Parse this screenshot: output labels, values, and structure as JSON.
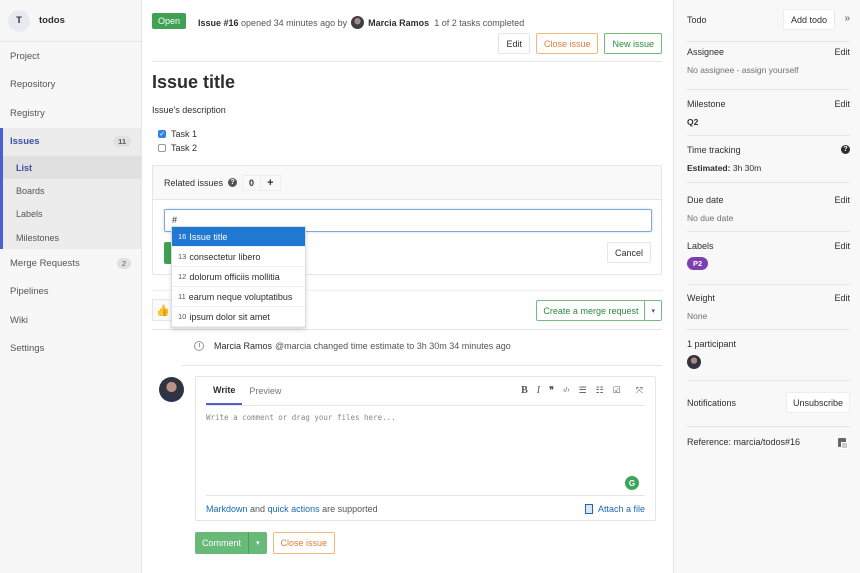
{
  "sidebar": {
    "project_initial": "T",
    "project_name": "todos",
    "items": [
      {
        "label": "Project"
      },
      {
        "label": "Repository"
      },
      {
        "label": "Registry"
      },
      {
        "label": "Issues",
        "badge": "11"
      },
      {
        "label": "Merge Requests",
        "badge": "2"
      },
      {
        "label": "Pipelines"
      },
      {
        "label": "Wiki"
      },
      {
        "label": "Settings"
      }
    ],
    "issues_subitems": [
      {
        "label": "List"
      },
      {
        "label": "Boards"
      },
      {
        "label": "Labels"
      },
      {
        "label": "Milestones"
      }
    ]
  },
  "header": {
    "status": "Open",
    "issue_ref": "Issue #16",
    "opened_text": "opened 34 minutes ago by",
    "author": "Marcia Ramos",
    "tasks_completed": "1 of 2 tasks completed",
    "buttons": {
      "edit": "Edit",
      "close": "Close issue",
      "new": "New issue"
    }
  },
  "issue": {
    "title": "Issue title",
    "description": "Issue's description",
    "tasks": [
      {
        "label": "Task 1",
        "checked": true
      },
      {
        "label": "Task 2",
        "checked": false
      }
    ]
  },
  "related": {
    "title": "Related issues",
    "count": "0",
    "add_icon": "+",
    "input_value": "#",
    "cancel_label": "Cancel",
    "suggestions": [
      {
        "num": "16",
        "title": "Issue title"
      },
      {
        "num": "13",
        "title": "consectetur libero"
      },
      {
        "num": "12",
        "title": "dolorum officiis mollitia"
      },
      {
        "num": "11",
        "title": "earum neque voluptatibus"
      },
      {
        "num": "10",
        "title": "ipsum dolor sit amet"
      }
    ]
  },
  "awards": {
    "thumbs_up_icon": "👍",
    "create_mr_label": "Create a merge request",
    "dropdown_icon": "▾"
  },
  "system_note": {
    "author": "Marcia Ramos",
    "text": "@marcia changed time estimate to 3h 30m 34 minutes ago"
  },
  "comment": {
    "tab_write": "Write",
    "tab_preview": "Preview",
    "toolbar": {
      "bold": "B",
      "italic": "I",
      "quote": "❞",
      "code": "‹/›",
      "ul": "☰",
      "ol": "☷",
      "task": "☑",
      "fullscreen": "⤧"
    },
    "placeholder": "Write a comment or drag your files here...",
    "grammarly": "G",
    "markdown_link": "Markdown",
    "and_text": "and",
    "quick_actions_link": "quick actions",
    "supported_text": "are supported",
    "attach_label": "Attach a file",
    "comment_button": "Comment",
    "comment_dropdown": "▾",
    "close_issue_button": "Close issue"
  },
  "right_sidebar": {
    "todo_label": "Todo",
    "add_todo": "Add todo",
    "collapse_icon": "»",
    "assignee": {
      "title": "Assignee",
      "edit": "Edit",
      "value": "No assignee - assign yourself"
    },
    "milestone": {
      "title": "Milestone",
      "edit": "Edit",
      "value": "Q2"
    },
    "time_tracking": {
      "title": "Time tracking",
      "help": "?",
      "estimated_label": "Estimated:",
      "estimated_value": "3h 30m"
    },
    "due_date": {
      "title": "Due date",
      "edit": "Edit",
      "value": "No due date"
    },
    "labels": {
      "title": "Labels",
      "edit": "Edit",
      "items": [
        {
          "name": "P2",
          "color": "#7e3fb0"
        }
      ]
    },
    "weight": {
      "title": "Weight",
      "edit": "Edit",
      "value": "None"
    },
    "participants": {
      "title": "1 participant"
    },
    "notifications": {
      "title": "Notifications",
      "button": "Unsubscribe"
    },
    "reference": {
      "text": "Reference: marcia/todos#16"
    }
  }
}
